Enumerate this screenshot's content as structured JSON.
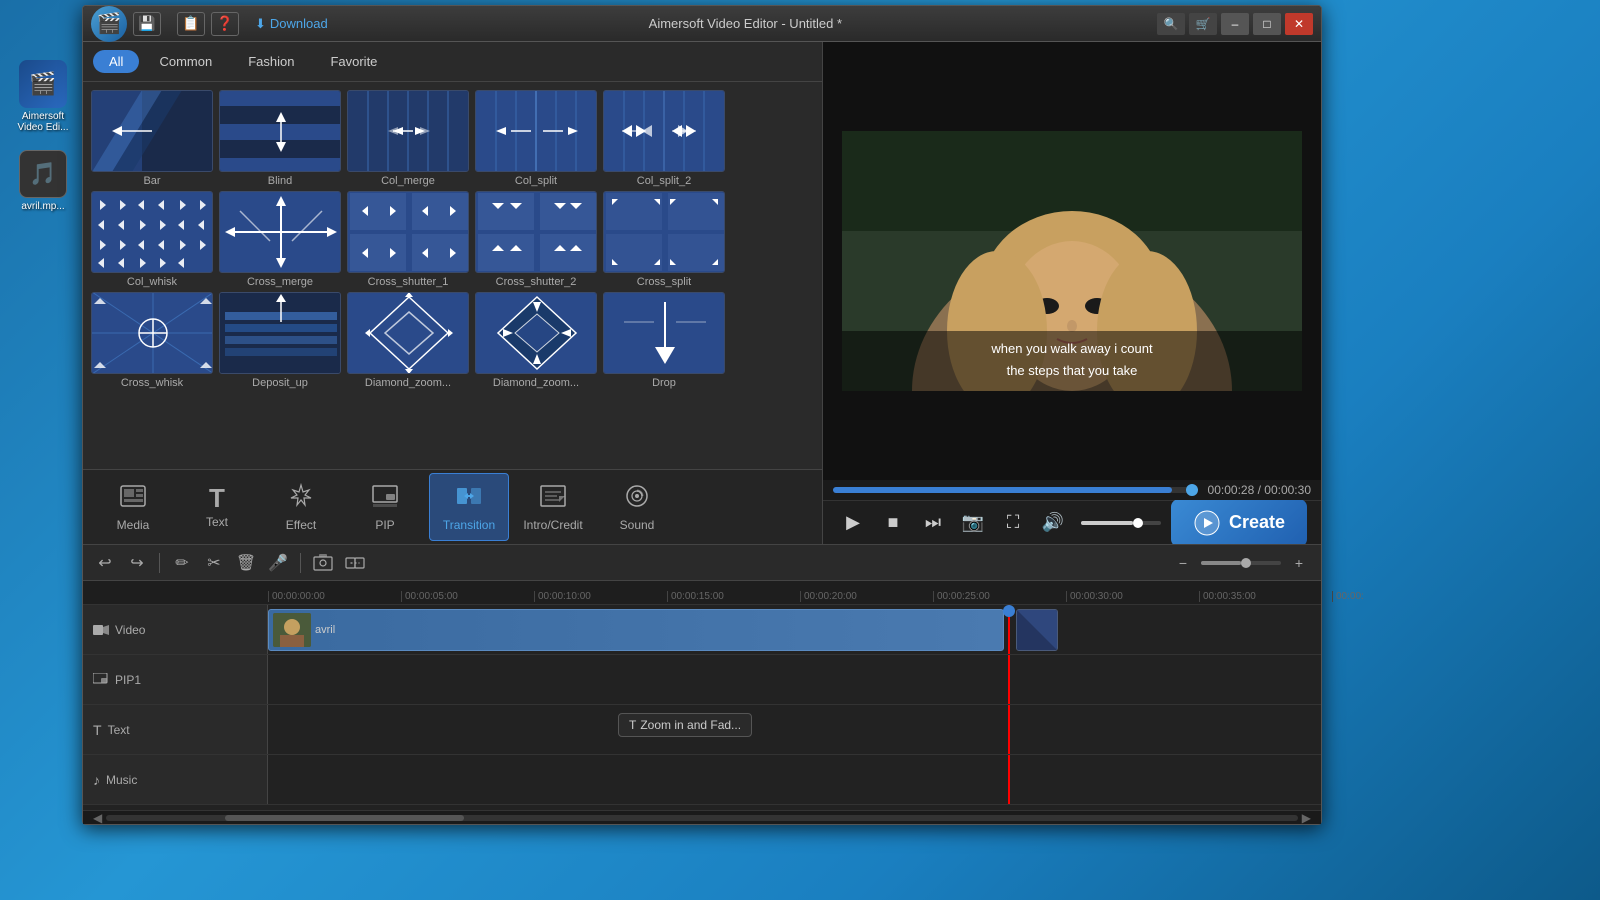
{
  "app": {
    "title": "Aimersoft Video Editor - Untitled *",
    "logo_icon": "🎬"
  },
  "titlebar": {
    "save_icon": "💾",
    "save2_icon": "📋",
    "help_icon": "❓",
    "download_label": "Download",
    "search_icon": "🔍",
    "store_icon": "🛒",
    "min_label": "–",
    "max_label": "□",
    "close_label": "✕"
  },
  "filter_tabs": {
    "all": "All",
    "common": "Common",
    "fashion": "Fashion",
    "favorite": "Favorite"
  },
  "transitions": [
    {
      "name": "Bar",
      "type": "bar"
    },
    {
      "name": "Blind",
      "type": "blind"
    },
    {
      "name": "Col_merge",
      "type": "col_merge"
    },
    {
      "name": "Col_split",
      "type": "col_split"
    },
    {
      "name": "Col_split_2",
      "type": "col_split_2"
    },
    {
      "name": "Col_whisk",
      "type": "col_whisk"
    },
    {
      "name": "Cross_merge",
      "type": "cross_merge"
    },
    {
      "name": "Cross_shutter_1",
      "type": "cross_shutter_1"
    },
    {
      "name": "Cross_shutter_2",
      "type": "cross_shutter_2"
    },
    {
      "name": "Cross_split",
      "type": "cross_split"
    },
    {
      "name": "Cross_whisk",
      "type": "cross_whisk"
    },
    {
      "name": "Deposit_up",
      "type": "deposit_up"
    },
    {
      "name": "Diamond_zoom...",
      "type": "diamond_zoom_1"
    },
    {
      "name": "Diamond_zoom...",
      "type": "diamond_zoom_2"
    },
    {
      "name": "Drop",
      "type": "drop"
    }
  ],
  "tools": [
    {
      "name": "Media",
      "icon": "▦",
      "active": false
    },
    {
      "name": "Text",
      "icon": "T",
      "active": false
    },
    {
      "name": "Effect",
      "icon": "✦",
      "active": false
    },
    {
      "name": "PIP",
      "icon": "⬛",
      "active": false
    },
    {
      "name": "Transition",
      "icon": "⇄",
      "active": true
    },
    {
      "name": "Intro/Credit",
      "icon": "🎬",
      "active": false
    },
    {
      "name": "Sound",
      "icon": "🎧",
      "active": false
    }
  ],
  "preview": {
    "subtitle_line1": "when you walk away i count",
    "subtitle_line2": "the steps that you take",
    "time_current": "00:00:28",
    "time_total": "00:00:30",
    "progress_percent": 93
  },
  "timeline": {
    "ruler_marks": [
      "00:00:00:00",
      "00:00:05:00",
      "00:00:10:00",
      "00:00:15:00",
      "00:00:20:00",
      "00:00:25:00",
      "00:00:30:00",
      "00:00:35:00",
      "00:00:"
    ],
    "tracks": [
      {
        "type": "video",
        "label": "Video",
        "icon": "📹"
      },
      {
        "type": "pip",
        "label": "PIP1",
        "icon": "📺"
      },
      {
        "type": "text",
        "label": "Text",
        "icon": "T"
      },
      {
        "type": "music",
        "label": "Music",
        "icon": "🎵"
      }
    ],
    "clip_name": "avril",
    "tooltip": "Zoom in and Fad..."
  },
  "create_btn": "Create",
  "desktop": {
    "app_name": "Aimersoft\nVideo Edi...",
    "file_name": "avril.mp..."
  }
}
